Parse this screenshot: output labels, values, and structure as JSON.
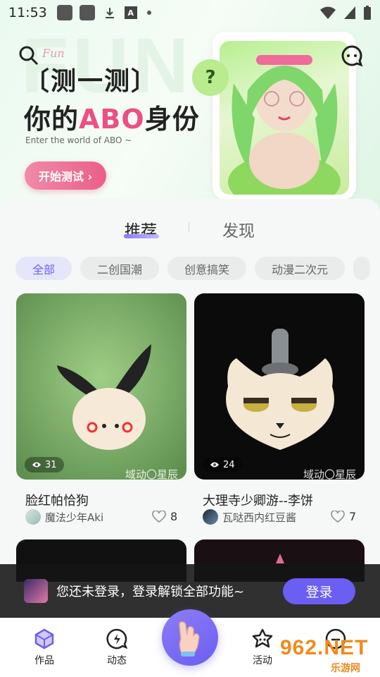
{
  "status_bar": {
    "time": "11:53"
  },
  "banner": {
    "bg_text": "FUN",
    "cursive": "Fun",
    "title_line1": "〔测一测〕",
    "title_line2_pre": "你的",
    "title_line2_abo": "ABO",
    "title_line2_post": "身份",
    "subtitle": "Enter the world of ABO ~",
    "start_button": "开始测试 ›",
    "bubble_char": "?"
  },
  "tabs": [
    {
      "label": "推荐",
      "active": true
    },
    {
      "label": "发现",
      "active": false
    }
  ],
  "categories": [
    {
      "label": "全部",
      "active": true
    },
    {
      "label": "二创国潮"
    },
    {
      "label": "创意搞笑"
    },
    {
      "label": "动漫二次元"
    }
  ],
  "cards": [
    {
      "title": "脸红帕恰狗",
      "author": "魔法少年Aki",
      "likes": "8",
      "views": "31",
      "watermark": "域动〇星辰"
    },
    {
      "title": "大理寺少卿游--李饼",
      "author": "瓦哒西内红豆酱",
      "likes": "7",
      "views": "24",
      "watermark": "域动〇星辰"
    }
  ],
  "login_prompt": {
    "text": "您还未登录，登录解锁全部功能~",
    "button": "登录"
  },
  "bottom_nav": [
    {
      "label": "作品",
      "icon": "cube-icon"
    },
    {
      "label": "动态",
      "icon": "lightning-bubble-icon"
    },
    {
      "label": "活动",
      "icon": "star-face-icon"
    },
    {
      "label": "",
      "icon": "profile-icon"
    }
  ],
  "overlay_watermark": {
    "main": "962.NET",
    "sub": "乐游网"
  },
  "colors": {
    "accent": "#6b5ef2",
    "pink": "#ee4f83"
  }
}
